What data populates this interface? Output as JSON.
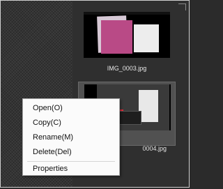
{
  "files": [
    {
      "name": "IMG_0003.jpg",
      "selected": false
    },
    {
      "name": "0004.jpg",
      "selected": true
    }
  ],
  "context_menu": {
    "items": [
      "Open(O)",
      "Copy(C)",
      "Rename(M)",
      "Delete(Del)"
    ],
    "properties": "Properties"
  },
  "colors": {
    "menu_background": "#fbfbfb",
    "grid_background": "#2f2f2f",
    "selection": "#515151",
    "caption_text": "#e6e6e6"
  }
}
